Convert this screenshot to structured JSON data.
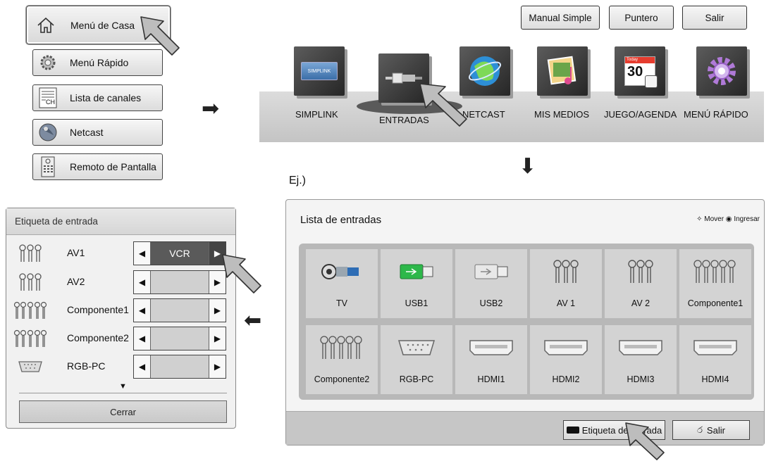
{
  "home_menu": {
    "home_label": "Menú de Casa",
    "items": [
      {
        "label": "Menú Rápido",
        "icon": "gear-icon"
      },
      {
        "label": "Lista de canales",
        "icon": "channel-list-icon"
      },
      {
        "label": "Netcast",
        "icon": "globe-icon"
      },
      {
        "label": "Remoto de Pantalla",
        "icon": "remote-icon"
      }
    ],
    "ch_badge": "CH"
  },
  "top_buttons": {
    "manual": "Manual Simple",
    "pointer": "Puntero",
    "exit": "Salir"
  },
  "launcher": {
    "apps": [
      {
        "label": "SIMPLINK",
        "icon": "simplink-icon"
      },
      {
        "label": "ENTRADAS",
        "icon": "input-cable-icon"
      },
      {
        "label": "NETCAST",
        "icon": "globe-icon"
      },
      {
        "label": "MIS MEDIOS",
        "icon": "media-icon"
      },
      {
        "label": "JUEGO/AGENDA",
        "icon": "calendar-icon"
      },
      {
        "label": "MENÚ RÁPIDO",
        "icon": "gear-icon"
      }
    ],
    "simplink_text": "SIMPLINK",
    "calendar_today": "Today",
    "calendar_day": "30"
  },
  "example_label": "Ej.)",
  "input_label_dialog": {
    "title": "Etiqueta de entrada",
    "rows": [
      {
        "name": "AV1",
        "value": "VCR",
        "icon": "av-connector-icon"
      },
      {
        "name": "AV2",
        "value": "",
        "icon": "av-connector-icon"
      },
      {
        "name": "Componente1",
        "value": "",
        "icon": "component-connector-icon"
      },
      {
        "name": "Componente2",
        "value": "",
        "icon": "component-connector-icon"
      },
      {
        "name": "RGB-PC",
        "value": "",
        "icon": "rgb-connector-icon"
      }
    ],
    "more_indicator": "▼",
    "close_label": "Cerrar"
  },
  "input_list_dialog": {
    "title": "Lista de entradas",
    "hint": "Mover  ◉ Ingresar",
    "items": [
      {
        "label": "TV",
        "icon": "antenna-connector-icon"
      },
      {
        "label": "USB1",
        "icon": "usb-icon"
      },
      {
        "label": "USB2",
        "icon": "usb-icon"
      },
      {
        "label": "AV 1",
        "icon": "av-connector-icon"
      },
      {
        "label": "AV 2",
        "icon": "av-connector-icon"
      },
      {
        "label": "Componente1",
        "icon": "component-connector-icon"
      },
      {
        "label": "Componente2",
        "icon": "component-connector-icon"
      },
      {
        "label": "RGB-PC",
        "icon": "rgb-connector-icon"
      },
      {
        "label": "HDMI1",
        "icon": "hdmi-icon"
      },
      {
        "label": "HDMI2",
        "icon": "hdmi-icon"
      },
      {
        "label": "HDMI3",
        "icon": "hdmi-icon"
      },
      {
        "label": "HDMI4",
        "icon": "hdmi-icon"
      }
    ],
    "footer": {
      "label_button": "Etiqueta de entrada",
      "exit_button": "Salir"
    }
  },
  "flow_arrows": [
    "right",
    "down",
    "left"
  ],
  "colors": {
    "panel_bg": "#f4f4f4",
    "grid_bg": "#b8b8b8",
    "cell_bg": "#d3d3d3",
    "active_arrow": "#444444",
    "usb_green": "#2db84a"
  }
}
